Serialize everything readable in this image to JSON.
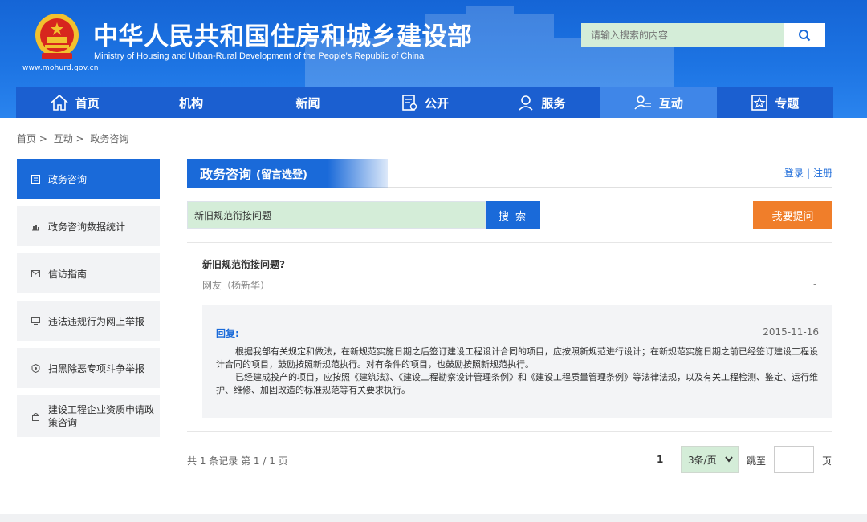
{
  "header": {
    "title_cn": "中华人民共和国住房和城乡建设部",
    "title_en": "Ministry of Housing and Urban-Rural Development of the People's Republic of China",
    "url": "www.mohurd.gov.cn",
    "search_placeholder": "请输入搜索的内容"
  },
  "nav": {
    "items": [
      {
        "label": "首页",
        "icon": "home-icon"
      },
      {
        "label": "机构",
        "icon": ""
      },
      {
        "label": "新闻",
        "icon": ""
      },
      {
        "label": "公开",
        "icon": "document-icon"
      },
      {
        "label": "服务",
        "icon": "service-icon"
      },
      {
        "label": "互动",
        "icon": "interaction-icon"
      },
      {
        "label": "专题",
        "icon": "star-icon"
      }
    ],
    "active": "互动"
  },
  "breadcrumb": [
    "首页 >",
    "互动 >",
    "政务咨询"
  ],
  "sidebar": {
    "items": [
      {
        "label": "政务咨询",
        "icon": "list-icon",
        "active": true
      },
      {
        "label": "政务咨询数据统计",
        "icon": "chart-icon"
      },
      {
        "label": "信访指南",
        "icon": "mail-icon"
      },
      {
        "label": "违法违规行为网上举报",
        "icon": "monitor-icon"
      },
      {
        "label": "扫黑除恶专项斗争举报",
        "icon": "shield-icon"
      },
      {
        "label": "建设工程企业资质申请政策咨询",
        "icon": "lock-icon"
      }
    ]
  },
  "main": {
    "tab_title": "政务咨询",
    "tab_subtitle": "(留言选登)",
    "login": "登录",
    "register": "注册",
    "search_value": "新旧规范衔接问题",
    "search_button": "搜 索",
    "ask_button": "我要提问"
  },
  "question": {
    "title": "新旧规范衔接问题?",
    "user": "网友（杨新华）",
    "dash": "-"
  },
  "reply": {
    "label": "回复:",
    "date": "2015-11-16",
    "para1": "根据我部有关规定和做法，在新规范实施日期之后签订建设工程设计合同的项目，应按照新规范进行设计；在新规范实施日期之前已经签订建设工程设计合同的项目，鼓励按照新规范执行。对有条件的项目，也鼓励按照新规范执行。",
    "para2": "已经建成投产的项目，应按照《建筑法》、《建设工程勘察设计管理条例》和《建设工程质量管理条例》等法律法规，以及有关工程检测、鉴定、运行维护、维修、加固改造的标准规范等有关要求执行。"
  },
  "pagination": {
    "records": "共 1 条记录 第 1 / 1 页",
    "current_page": "1",
    "page_size": "3条/页",
    "jump_label": "跳至",
    "page_label": "页"
  }
}
